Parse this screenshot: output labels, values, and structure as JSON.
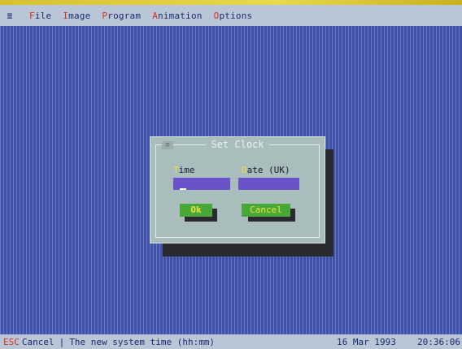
{
  "menubar": {
    "system_icon": "≡",
    "items": [
      {
        "hotkey": "F",
        "rest": "ile"
      },
      {
        "hotkey": "I",
        "rest": "mage"
      },
      {
        "hotkey": "P",
        "rest": "rogram"
      },
      {
        "hotkey": "A",
        "rest": "nimation"
      },
      {
        "hotkey": "O",
        "rest": "ptions"
      }
    ]
  },
  "dialog": {
    "close_glyph": "≡",
    "title": "Set Clock",
    "time_label": {
      "hotkey": "T",
      "rest": "ime"
    },
    "date_label": {
      "hotkey": "D",
      "rest": "ate (UK)"
    },
    "time_value": "",
    "date_value": "",
    "ok_label": "Ok",
    "cancel_label": "Cancel"
  },
  "statusbar": {
    "esc_key": "ESC",
    "esc_label": "Cancel",
    "separator": "|",
    "message": "The new system time (hh:mm)",
    "date": "16 Mar 1993",
    "time": "20:36:06"
  },
  "colors": {
    "desktop": "#4052a8",
    "menubar": "#b9c6d6",
    "hotkey": "#d83020",
    "dialog": "#a9bdbd",
    "input": "#6a52c8",
    "button": "#48a838",
    "button_text": "#f0e040"
  }
}
